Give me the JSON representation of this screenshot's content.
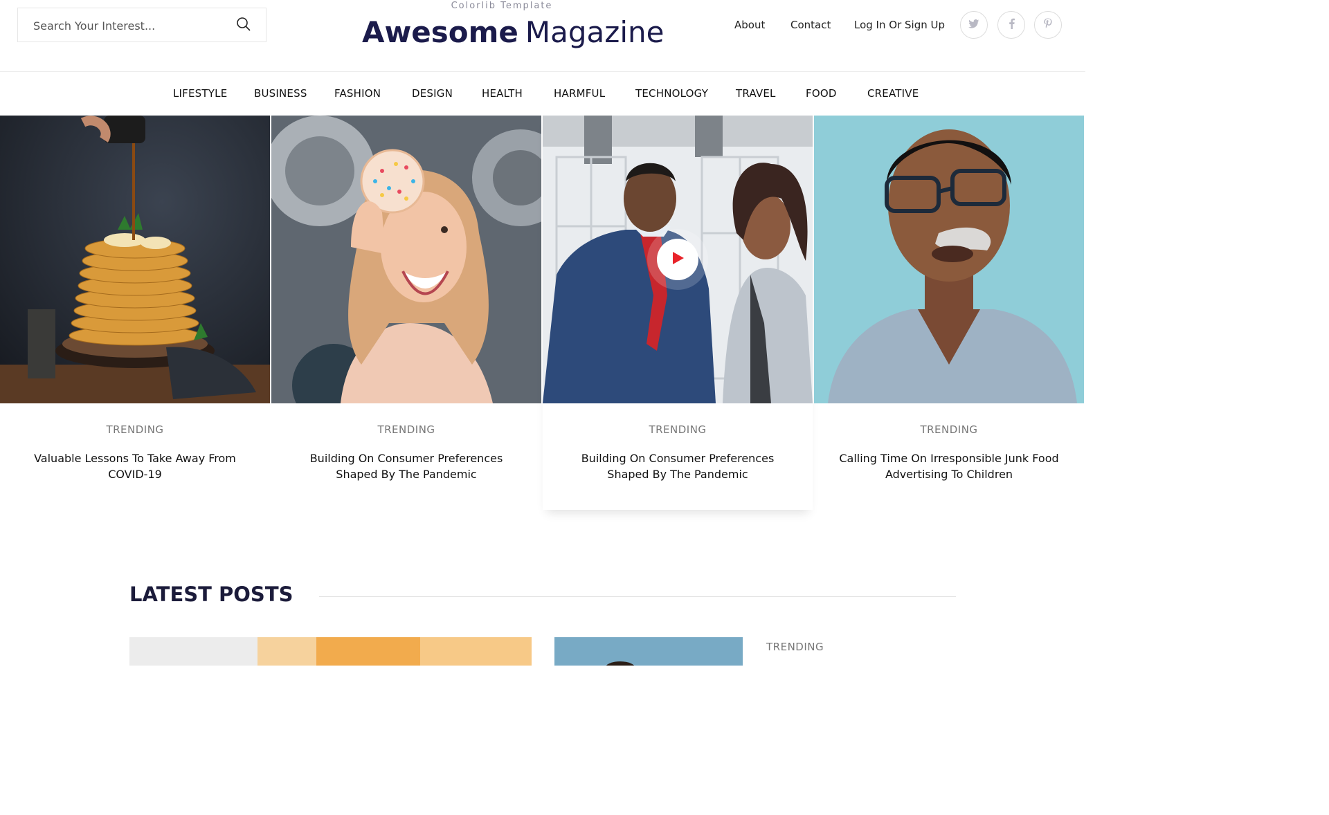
{
  "search": {
    "placeholder": "Search Your Interest..."
  },
  "brand": {
    "tagline": "Colorlib Template",
    "name_bold": "Awesome",
    "name_light": "Magazine"
  },
  "top_links": [
    "About",
    "Contact",
    "Log In Or Sign Up"
  ],
  "social": [
    "twitter-icon",
    "facebook-icon",
    "pinterest-icon"
  ],
  "nav": [
    "LIFESTYLE",
    "BUSINESS",
    "FASHION",
    "DESIGN",
    "HEALTH",
    "HARMFUL",
    "TECHNOLOGY",
    "TRAVEL",
    "FOOD",
    "CREATIVE"
  ],
  "cards": [
    {
      "tag": "TRENDING",
      "title": "Valuable Lessons To Take Away From COVID-19"
    },
    {
      "tag": "TRENDING",
      "title": "Building On Consumer Preferences Shaped By The Pandemic"
    },
    {
      "tag": "TRENDING",
      "title": "Building On Consumer Preferences Shaped By The Pandemic"
    },
    {
      "tag": "TRENDING",
      "title": "Calling Time On Irresponsible Junk Food Advertising To Children"
    }
  ],
  "latest": {
    "heading": "LATEST POSTS",
    "tag": "TRENDING"
  },
  "colors": {
    "brand": "#1b1b4b",
    "play": "#e8232a"
  }
}
